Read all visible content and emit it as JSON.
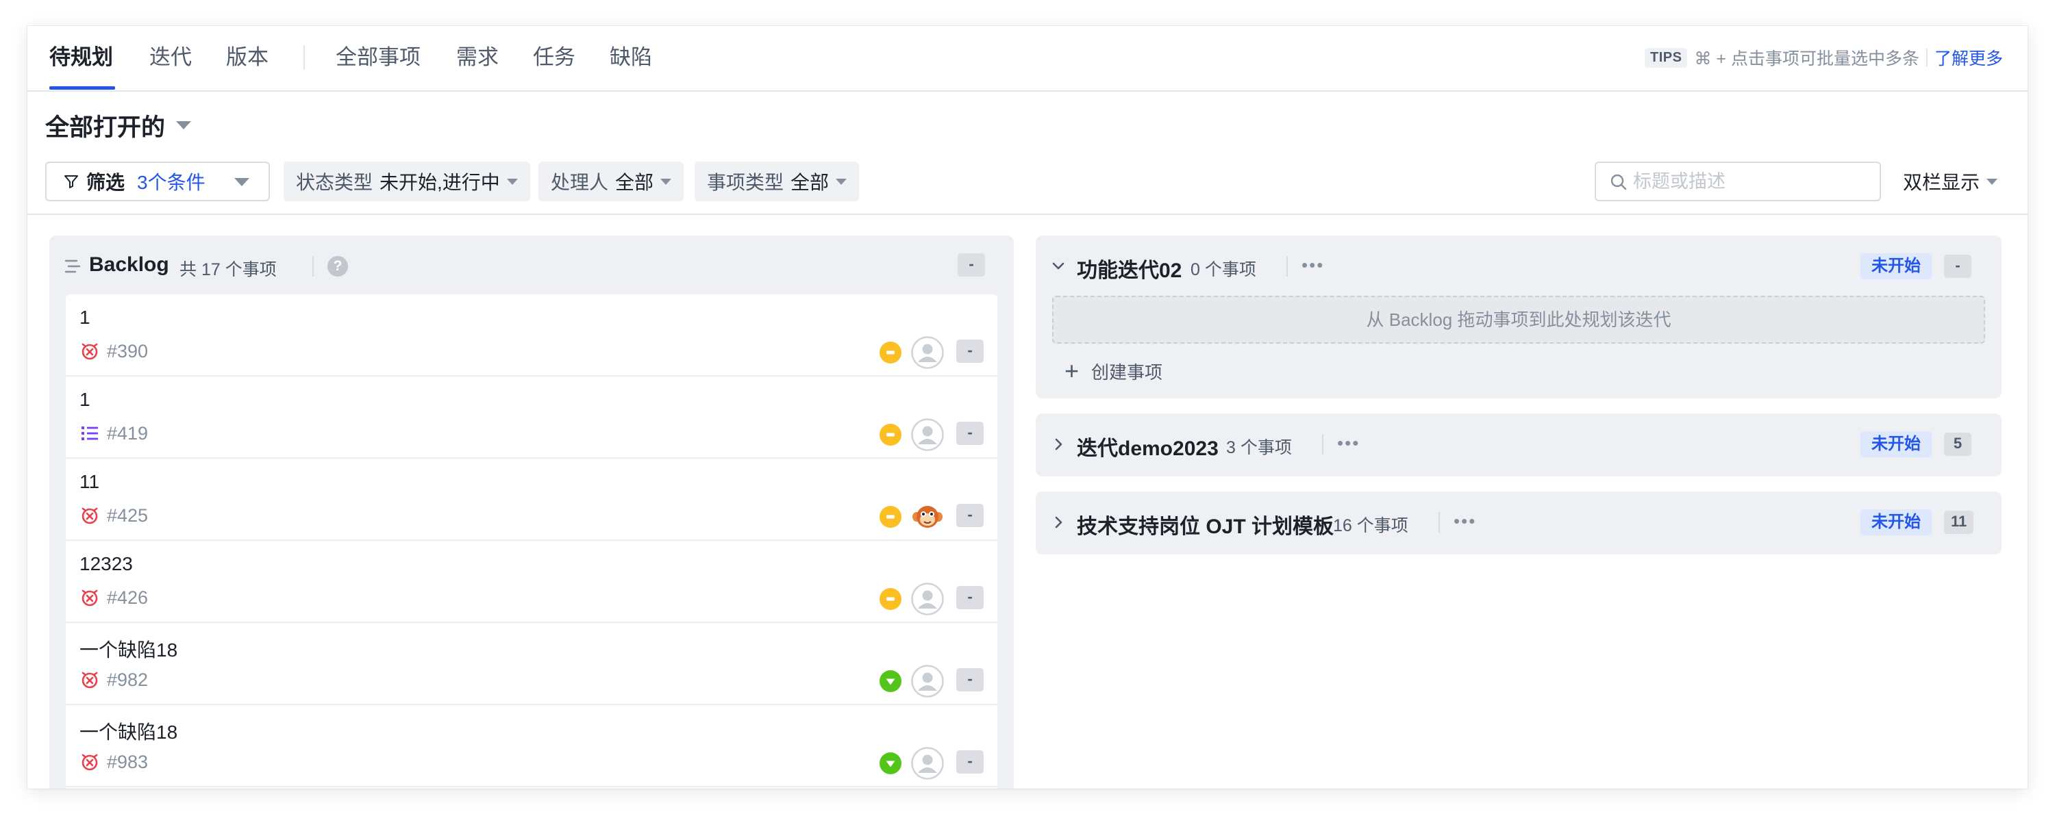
{
  "nav": {
    "tabs": [
      "待规划",
      "迭代",
      "版本",
      "全部事项",
      "需求",
      "任务",
      "缺陷"
    ],
    "active": "待规划"
  },
  "tips": {
    "badge": "TIPS",
    "text": "⌘ + 点击事项可批量选中多条",
    "link": "了解更多"
  },
  "view": {
    "title": "全部打开的"
  },
  "filters": {
    "main": {
      "label": "筛选",
      "value": "3个条件"
    },
    "status": {
      "key": "状态类型",
      "value": "未开始,进行中"
    },
    "assignee": {
      "key": "处理人",
      "value": "全部"
    },
    "type": {
      "key": "事项类型",
      "value": "全部"
    }
  },
  "search": {
    "placeholder": "标题或描述",
    "value": ""
  },
  "layout": {
    "label": "双栏显示"
  },
  "backlog": {
    "title": "Backlog",
    "count": "共 17 个事项",
    "help": "?",
    "badge": "-",
    "items": [
      {
        "title": "1",
        "id": "#390",
        "type": "bug-icon",
        "priority": "medium",
        "assignee": "unassigned",
        "badge": "-"
      },
      {
        "title": "1",
        "id": "#419",
        "type": "requirement-icon",
        "priority": "medium",
        "assignee": "unassigned",
        "badge": "-"
      },
      {
        "title": "11",
        "id": "#425",
        "type": "bug-icon",
        "priority": "medium",
        "assignee": "monkey",
        "badge": "-"
      },
      {
        "title": "12323",
        "id": "#426",
        "type": "bug-icon",
        "priority": "medium",
        "assignee": "unassigned",
        "badge": "-"
      },
      {
        "title": "一个缺陷18",
        "id": "#982",
        "type": "bug-icon",
        "priority": "low",
        "assignee": "unassigned",
        "badge": "-"
      },
      {
        "title": "一个缺陷18",
        "id": "#983",
        "type": "bug-icon",
        "priority": "low",
        "assignee": "unassigned",
        "badge": "-"
      }
    ]
  },
  "iterations": [
    {
      "name": "功能迭代02",
      "count": "0 个事项",
      "status": "未开始",
      "badge": "-",
      "expanded": true,
      "dropzone": "从 Backlog 拖动事项到此处规划该迭代",
      "create": "创建事项"
    },
    {
      "name": "迭代demo2023",
      "count": "3 个事项",
      "status": "未开始",
      "badge": "5",
      "expanded": false
    },
    {
      "name": "技术支持岗位 OJT 计划模板",
      "count": "16 个事项",
      "status": "未开始",
      "badge": "11",
      "expanded": false
    }
  ],
  "colors": {
    "accent": "#2356e6",
    "bug": "#e8414a",
    "requirement": "#7b3ff2",
    "priority_medium": "#fbbf24",
    "priority_low": "#52c41a",
    "status_bg": "#dde8fd"
  }
}
